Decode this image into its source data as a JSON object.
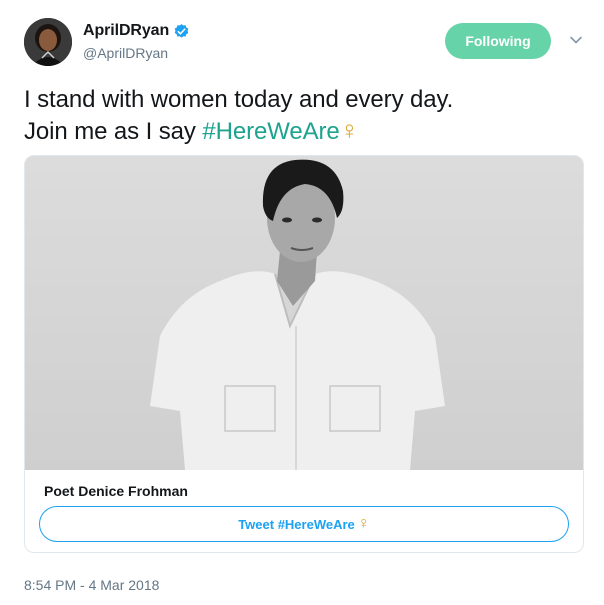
{
  "author": {
    "display_name": "AprilDRyan",
    "handle": "@AprilDRyan",
    "verified": true,
    "avatar_icon": "avatar-photo"
  },
  "follow_button": {
    "label": "Following",
    "color": "#67d3a8"
  },
  "more_menu": {
    "icon": "chevron-down-icon"
  },
  "tweet": {
    "line1": "I stand with women today and every day.",
    "line2_prefix": "Join me as I say ",
    "hashtag": "#HereWeAre",
    "emoji": "♀"
  },
  "card": {
    "title": "Poet Denice Frohman",
    "button_label": "Tweet #HereWeAre",
    "button_emoji": "♀"
  },
  "timestamp": "8:54 PM - 4 Mar 2018",
  "colors": {
    "hashtag": "#1da38e",
    "link": "#1da1f2",
    "venus": "#d6a630",
    "muted": "#657786"
  }
}
